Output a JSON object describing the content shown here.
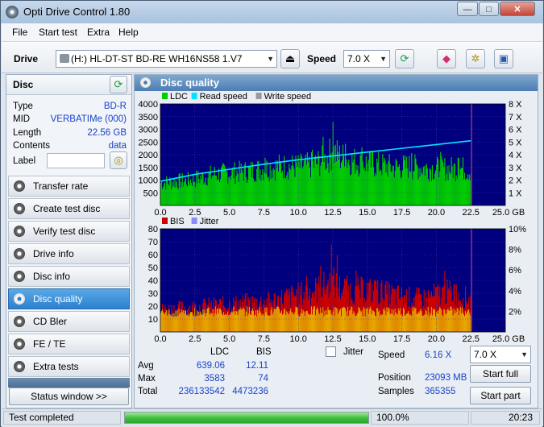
{
  "window": {
    "title": "Opti Drive Control 1.80",
    "minimize": "—",
    "maximize": "□",
    "close": "✕"
  },
  "menu": [
    "File",
    "Start test",
    "Extra",
    "Help"
  ],
  "toolbar": {
    "drive_label": "Drive",
    "drive_value": "(H:)   HL-DT-ST BD-RE  WH16NS58 1.V7",
    "speed_label": "Speed",
    "speed_value": "7.0 X",
    "icons": [
      "eject-icon",
      "refresh-icon",
      "eraser-icon",
      "settings-icon",
      "save-icon"
    ]
  },
  "disc": {
    "title": "Disc",
    "rows": [
      {
        "label": "Type",
        "value": "BD-R"
      },
      {
        "label": "MID",
        "value": "VERBATIMe (000)"
      },
      {
        "label": "Length",
        "value": "22.56 GB"
      },
      {
        "label": "Contents",
        "value": "data"
      }
    ],
    "label_field": "Label"
  },
  "nav": [
    {
      "label": "Transfer rate",
      "active": false
    },
    {
      "label": "Create test disc",
      "active": false
    },
    {
      "label": "Verify test disc",
      "active": false
    },
    {
      "label": "Drive info",
      "active": false
    },
    {
      "label": "Disc info",
      "active": false
    },
    {
      "label": "Disc quality",
      "active": true
    },
    {
      "label": "CD Bler",
      "active": false
    },
    {
      "label": "FE / TE",
      "active": false
    },
    {
      "label": "Extra tests",
      "active": false
    }
  ],
  "status_window_button": "Status window >>",
  "panel_title": "Disc quality",
  "chart_data": [
    {
      "type": "area",
      "legend": [
        "LDC",
        "Read speed",
        "Write speed"
      ],
      "colors": {
        "LDC": "#00cc00",
        "Read speed": "#00e5ff",
        "Write speed": "#999999",
        "background": "#00007f"
      },
      "x_ticks": [
        "0.0",
        "2.5",
        "5.0",
        "7.5",
        "10.0",
        "12.5",
        "15.0",
        "17.5",
        "20.0",
        "22.5",
        "25.0 GB"
      ],
      "y_ticks_left": [
        "4000",
        "3500",
        "3000",
        "2500",
        "2000",
        "1500",
        "1000",
        "500"
      ],
      "y_ticks_right": [
        "8 X",
        "7 X",
        "6 X",
        "5 X",
        "4 X",
        "3 X",
        "2 X",
        "1 X"
      ],
      "xlim": [
        0,
        25
      ],
      "ylim": [
        0,
        4000
      ],
      "y2lim": [
        0,
        8
      ],
      "data_end": 22.56,
      "ldc_profile": [
        [
          0,
          1050
        ],
        [
          1,
          1100
        ],
        [
          2,
          1150
        ],
        [
          3,
          1300
        ],
        [
          4,
          1450
        ],
        [
          5,
          1500
        ],
        [
          6,
          1550
        ],
        [
          7,
          1650
        ],
        [
          8,
          1750
        ],
        [
          9,
          1800
        ],
        [
          10,
          1800
        ],
        [
          11,
          1850
        ],
        [
          12,
          2150
        ],
        [
          12.5,
          2500
        ],
        [
          13,
          2250
        ],
        [
          14,
          2050
        ],
        [
          15,
          1950
        ],
        [
          16,
          1850
        ],
        [
          17,
          1750
        ],
        [
          18,
          1800
        ],
        [
          19,
          1750
        ],
        [
          20,
          1700
        ],
        [
          21,
          1700
        ],
        [
          22,
          1700
        ],
        [
          22.56,
          1600
        ]
      ],
      "ldc_peaks": [
        [
          12.5,
          3583
        ],
        [
          11.8,
          2950
        ],
        [
          13.4,
          2650
        ],
        [
          14.6,
          2500
        ],
        [
          11.0,
          2400
        ],
        [
          15.4,
          2350
        ],
        [
          21.6,
          2500
        ],
        [
          20.3,
          2300
        ],
        [
          18.2,
          2250
        ],
        [
          8.6,
          2200
        ],
        [
          7.6,
          2050
        ]
      ],
      "read_speed": [
        [
          0,
          1.9
        ],
        [
          2.5,
          2.45
        ],
        [
          5,
          2.85
        ],
        [
          7.5,
          3.25
        ],
        [
          10,
          3.6
        ],
        [
          12.5,
          3.9
        ],
        [
          15,
          4.2
        ],
        [
          17.5,
          4.5
        ],
        [
          20,
          4.8
        ],
        [
          22.5,
          5.1
        ]
      ]
    },
    {
      "type": "area",
      "legend": [
        "BIS",
        "Jitter"
      ],
      "colors": {
        "BIS": "#cc0000",
        "BIS_low": "#e6a800",
        "Jitter": "#8a8aff",
        "background": "#00007f"
      },
      "x_ticks": [
        "0.0",
        "2.5",
        "5.0",
        "7.5",
        "10.0",
        "12.5",
        "15.0",
        "17.5",
        "20.0",
        "22.5",
        "25.0 GB"
      ],
      "y_ticks_left": [
        "80",
        "70",
        "60",
        "50",
        "40",
        "30",
        "20",
        "10"
      ],
      "y_ticks_right": [
        "10%",
        "8%",
        "6%",
        "4%",
        "2%"
      ],
      "xlim": [
        0,
        25
      ],
      "ylim": [
        0,
        80
      ],
      "y2lim": [
        0,
        10
      ],
      "data_end": 22.56,
      "bis_profile": [
        [
          0,
          20
        ],
        [
          2,
          22
        ],
        [
          4,
          24
        ],
        [
          6,
          26
        ],
        [
          8,
          28
        ],
        [
          10,
          34
        ],
        [
          11,
          37
        ],
        [
          12,
          42
        ],
        [
          12.5,
          45
        ],
        [
          13,
          40
        ],
        [
          14,
          37
        ],
        [
          15,
          38
        ],
        [
          16,
          36
        ],
        [
          17,
          33
        ],
        [
          18,
          31
        ],
        [
          19,
          30
        ],
        [
          20,
          34
        ],
        [
          21,
          36
        ],
        [
          22,
          32
        ],
        [
          22.56,
          28
        ]
      ],
      "bis_peaks": [
        [
          12.4,
          74
        ],
        [
          12.8,
          65
        ],
        [
          11.6,
          56
        ],
        [
          13.5,
          55
        ],
        [
          14.2,
          52
        ],
        [
          15.6,
          53
        ],
        [
          20.6,
          52
        ],
        [
          21.3,
          49
        ],
        [
          10.6,
          47
        ],
        [
          16.8,
          45
        ],
        [
          9.6,
          40
        ]
      ]
    }
  ],
  "stats": {
    "col_ldc": "LDC",
    "col_bis": "BIS",
    "rows": [
      {
        "label": "Avg",
        "ldc": "639.06",
        "bis": "12.11"
      },
      {
        "label": "Max",
        "ldc": "3583",
        "bis": "74"
      },
      {
        "label": "Total",
        "ldc": "236133542",
        "bis": "4473236"
      }
    ],
    "jitter_label": "Jitter",
    "jitter_checked": false,
    "speed_label": "Speed",
    "speed_value": "6.16 X",
    "speed_select": "7.0 X",
    "position_label": "Position",
    "position_value": "23093 MB",
    "samples_label": "Samples",
    "samples_value": "365355",
    "start_full": "Start full",
    "start_part": "Start part"
  },
  "status": {
    "text": "Test completed",
    "progress": 1.0,
    "percent": "100.0%",
    "time": "20:23"
  }
}
